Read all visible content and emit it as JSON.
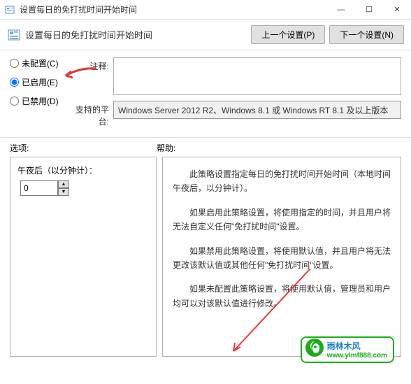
{
  "window": {
    "title": "设置每日的免打扰时间开始时间",
    "min": "—",
    "max": "☐",
    "close": "✕"
  },
  "header": {
    "title": "设置每日的免打扰时间开始时间",
    "prev": "上一个设置(P)",
    "next": "下一个设置(N)"
  },
  "radios": {
    "unconfigured": "未配置(C)",
    "enabled": "已启用(E)",
    "disabled": "已禁用(D)",
    "selected": "enabled"
  },
  "fields": {
    "comment_label": "注释:",
    "comment_value": "",
    "platform_label": "支持的平台:",
    "platform_value": "Windows Server 2012 R2、Windows 8.1 或 Windows RT 8.1 及以上版本"
  },
  "sections": {
    "options": "选项:",
    "help": "帮助:"
  },
  "options": {
    "minutes_label": "午夜后（以分钟计）：",
    "minutes_value": "0"
  },
  "help": {
    "p1": "此策略设置指定每日的免打扰时间开始时间（本地时间午夜后，以分钟计）。",
    "p2": "如果启用此策略设置，将使用指定的时间，并且用户将无法自定义任何\"免打扰时间\"设置。",
    "p3": "如果禁用此策略设置，将使用默认值，并且用户将无法更改该默认值或其他任何\"免打扰时间\"设置。",
    "p4": "如果未配置此策略设置，将使用默认值，管理员和用户均可以对该默认值进行修改。"
  },
  "watermark": {
    "title": "雨林木风",
    "url": "www.ylmf888.com"
  }
}
